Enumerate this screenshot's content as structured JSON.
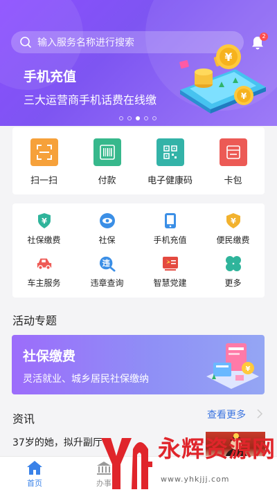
{
  "search": {
    "placeholder": "输入服务名称进行搜索"
  },
  "notifications": {
    "badge": "2"
  },
  "banner": {
    "title": "手机充值",
    "subtitle": "三大运营商手机话费在线缴",
    "page_count": 5,
    "active_page": 3
  },
  "tools": [
    {
      "label": "扫一扫",
      "icon": "scan-icon",
      "color": "#f6a13a"
    },
    {
      "label": "付款",
      "icon": "barcode-icon",
      "color": "#37b88c"
    },
    {
      "label": "电子健康码",
      "icon": "qr-code-icon",
      "color": "#33b3a8"
    },
    {
      "label": "卡包",
      "icon": "card-wallet-icon",
      "color": "#ec5a55"
    }
  ],
  "services": [
    {
      "label": "社保缴费",
      "icon": "shield-yuan-icon",
      "color": "#2fb49b"
    },
    {
      "label": "社保",
      "icon": "eye-badge-icon",
      "color": "#3b8fe6"
    },
    {
      "label": "手机充值",
      "icon": "phone-icon",
      "color": "#3b8fe6"
    },
    {
      "label": "便民缴费",
      "icon": "yuan-shield-icon",
      "color": "#f2b22e"
    },
    {
      "label": "车主服务",
      "icon": "car-icon",
      "color": "#ee5a55"
    },
    {
      "label": "违章查询",
      "icon": "violation-search-icon",
      "color": "#3b8fe6"
    },
    {
      "label": "智慧党建",
      "icon": "party-flag-icon",
      "color": "#e44a40"
    },
    {
      "label": "更多",
      "icon": "clover-icon",
      "color": "#2fb49b"
    }
  ],
  "activity": {
    "section_title": "活动专题",
    "promo_title": "社保缴费",
    "promo_subtitle": "灵活就业、城乡居民社保缴纳"
  },
  "news": {
    "section_title": "资讯",
    "more_label": "查看更多",
    "items": [
      {
        "title": "37岁的她，拟升副厅"
      }
    ]
  },
  "tabbar": [
    {
      "label": "首页",
      "icon": "home-icon",
      "active": true
    },
    {
      "label": "办事",
      "icon": "building-icon",
      "active": false
    },
    {
      "label": "",
      "icon": "",
      "active": false
    },
    {
      "label": "",
      "icon": "",
      "active": false
    }
  ],
  "watermark": {
    "text": "永辉资源网",
    "url": "www.yhkjjj.com"
  },
  "colors": {
    "primary": "#8b4dff",
    "link": "#3b74e0",
    "tab_active": "#3a82e8"
  }
}
